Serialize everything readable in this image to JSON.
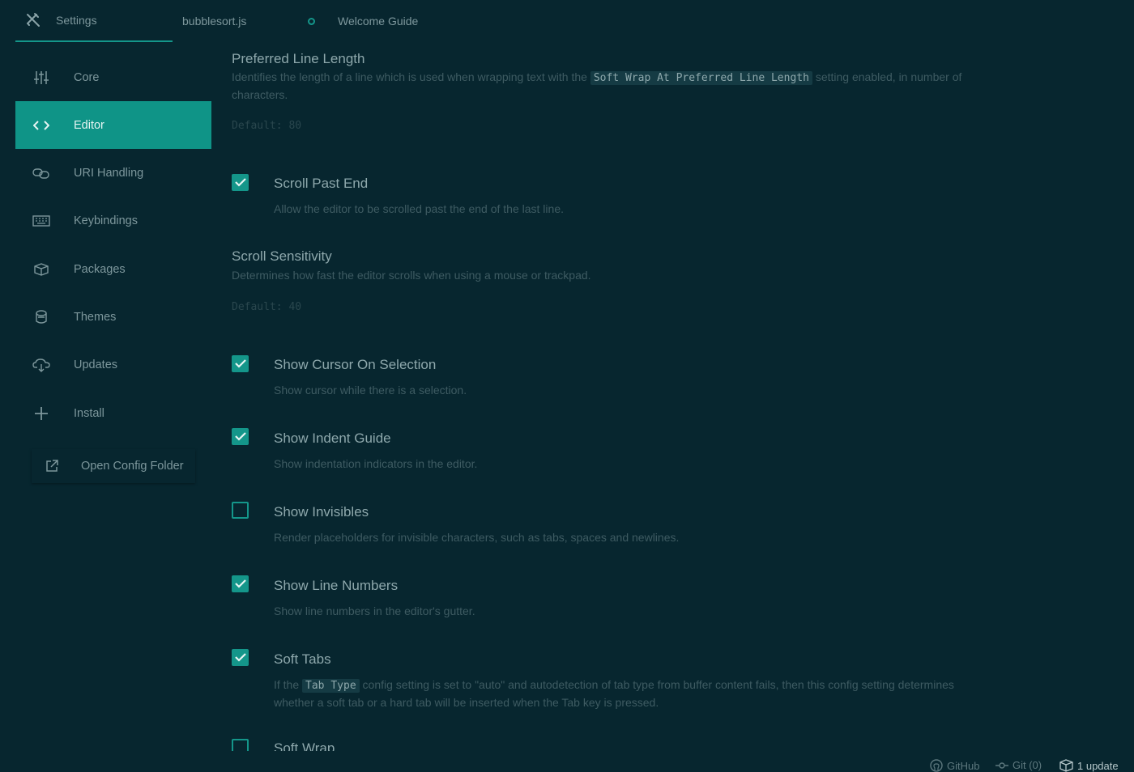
{
  "tabs": [
    {
      "label": "Settings",
      "icon": "tools-icon",
      "active": true
    },
    {
      "label": "bubblesort.js",
      "modified": true
    },
    {
      "label": "Welcome Guide"
    }
  ],
  "sidebar": {
    "items": [
      {
        "label": "Core",
        "icon": "sliders-icon"
      },
      {
        "label": "Editor",
        "icon": "code-icon",
        "active": true
      },
      {
        "label": "URI Handling",
        "icon": "link-icon"
      },
      {
        "label": "Keybindings",
        "icon": "keyboard-icon"
      },
      {
        "label": "Packages",
        "icon": "package-icon"
      },
      {
        "label": "Themes",
        "icon": "paintcan-icon"
      },
      {
        "label": "Updates",
        "icon": "cloud-download-icon"
      },
      {
        "label": "Install",
        "icon": "plus-icon"
      }
    ],
    "open_config": {
      "label": "Open Config Folder",
      "icon": "external-link-icon"
    }
  },
  "settings": {
    "preferred_line_length": {
      "title": "Preferred Line Length",
      "desc_pre": "Identifies the length of a line which is used when wrapping text with the",
      "desc_code": "Soft Wrap At Preferred Line Length",
      "desc_post": "setting enabled, in number of characters.",
      "default": "Default: 80"
    },
    "scroll_past_end": {
      "title": "Scroll Past End",
      "desc": "Allow the editor to be scrolled past the end of the last line.",
      "checked": true
    },
    "scroll_sensitivity": {
      "title": "Scroll Sensitivity",
      "desc": "Determines how fast the editor scrolls when using a mouse or trackpad.",
      "default": "Default: 40"
    },
    "show_cursor_on_selection": {
      "title": "Show Cursor On Selection",
      "desc": "Show cursor while there is a selection.",
      "checked": true
    },
    "show_indent_guide": {
      "title": "Show Indent Guide",
      "desc": "Show indentation indicators in the editor.",
      "checked": true
    },
    "show_invisibles": {
      "title": "Show Invisibles",
      "desc": "Render placeholders for invisible characters, such as tabs, spaces and newlines.",
      "checked": false
    },
    "show_line_numbers": {
      "title": "Show Line Numbers",
      "desc": "Show line numbers in the editor's gutter.",
      "checked": true
    },
    "soft_tabs": {
      "title": "Soft Tabs",
      "desc_pre": "If the",
      "desc_code": "Tab Type",
      "desc_post": "config setting is set to \"auto\" and autodetection of tab type from buffer content fails, then this config setting determines whether a soft tab or a hard tab will be inserted when the Tab key is pressed.",
      "checked": true
    },
    "soft_wrap": {
      "title": "Soft Wrap",
      "checked": false
    }
  },
  "statusbar": {
    "github": {
      "label": "GitHub",
      "icon": "github-icon"
    },
    "git": {
      "label": "Git (0)",
      "icon": "git-commit-icon"
    },
    "update": {
      "label": "1 update",
      "icon": "package-update-icon"
    }
  },
  "colors": {
    "accent": "#14968a",
    "background": "#07262f"
  }
}
